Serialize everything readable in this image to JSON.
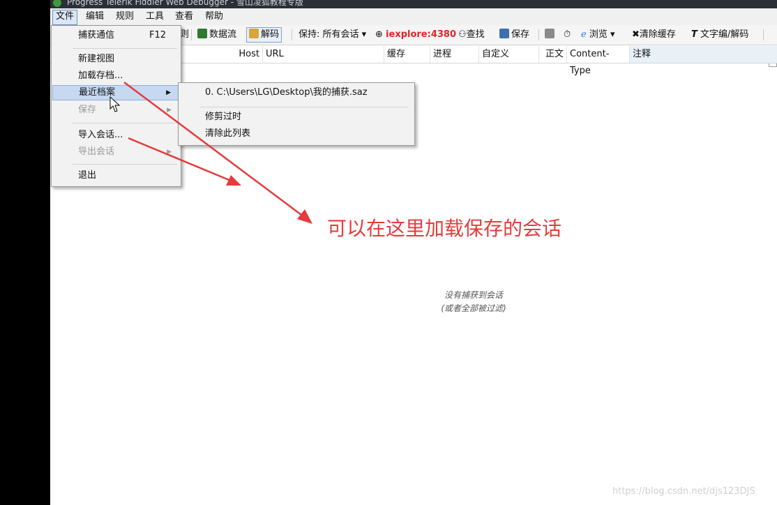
{
  "window": {
    "title": "Progress Telerik Fiddler Web Debugger - 雪山凌狐教程专版"
  },
  "menubar": {
    "items": [
      "文件",
      "编辑",
      "规则",
      "工具",
      "查看",
      "帮助"
    ]
  },
  "toolbar": {
    "replay_partial": "则",
    "stream": "数据流",
    "decode": "解码",
    "keep": "保持: 所有会话",
    "process": "iexplore:4380",
    "find": "查找",
    "save": "保存",
    "browse": "浏览",
    "clear_cache": "清除缓存",
    "text_wizard": "文字编/解码"
  },
  "columns": {
    "host": "Host",
    "url": "URL",
    "cache": "缓存",
    "process": "进程",
    "custom": "自定义",
    "body": "正文",
    "content_type": "Content-Type",
    "notes": "注释"
  },
  "file_menu": {
    "capture": "捕获通信",
    "capture_shortcut": "F12",
    "new_viewer": "新建视图",
    "load_archive": "加载存档...",
    "recent_archives": "最近档案",
    "save": "保存",
    "import_sessions": "导入会话...",
    "export_sessions": "导出会话",
    "exit": "退出"
  },
  "recent_menu": {
    "file0": "0. C:\\Users\\LG\\Desktop\\我的捕获.saz",
    "prune": "修剪过时",
    "clear_list": "清除此列表"
  },
  "empty_state": {
    "line1": "没有捕获到会话",
    "line2": "(或者全部被过滤)"
  },
  "annotation": {
    "text": "可以在这里加载保存的会话",
    "color": "#e53b3b"
  },
  "watermark": "https://blog.csdn.net/djs123DJS",
  "colors": {
    "highlight": "#c6d9f1",
    "process_text": "#e0242a"
  }
}
